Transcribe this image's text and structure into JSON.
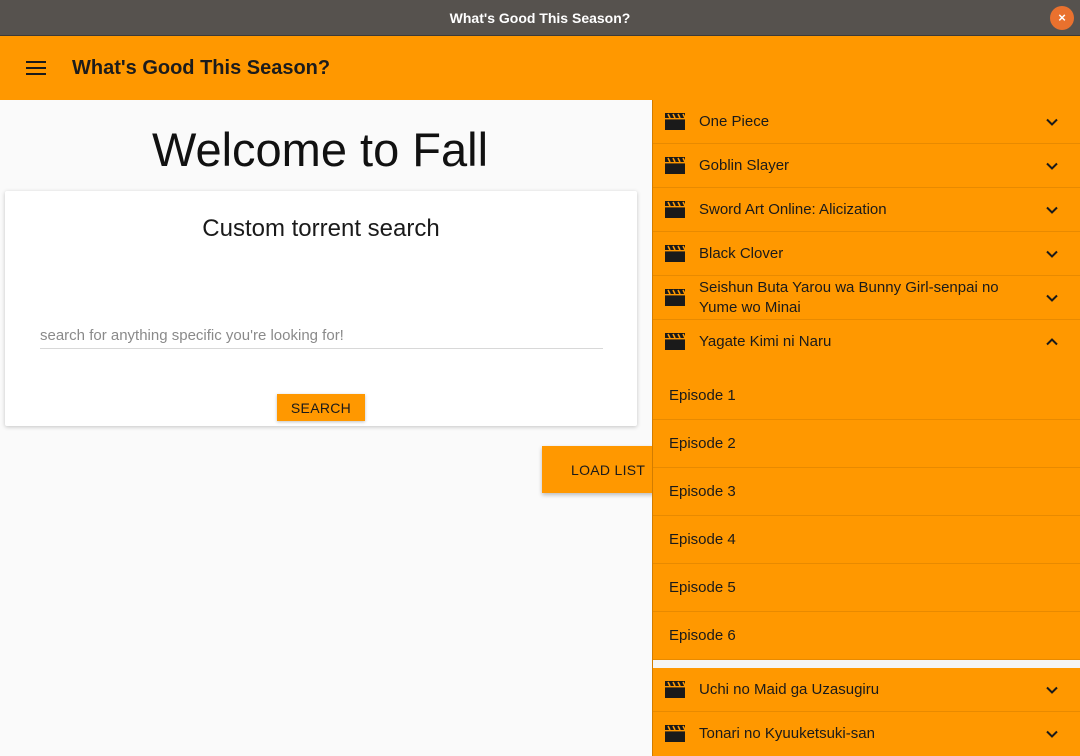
{
  "window": {
    "title": "What's Good This Season?",
    "close_icon": "×"
  },
  "appbar": {
    "title": "What's Good This Season?",
    "menu_icon": "hamburger-menu"
  },
  "main": {
    "welcome": "Welcome to Fall",
    "card": {
      "title": "Custom torrent search",
      "placeholder": "search for anything specific you're looking for!",
      "value": "",
      "button": "SEARCH"
    },
    "load_button": "LOAD LIST"
  },
  "panel": {
    "shows_top": [
      "One Piece",
      "Goblin Slayer",
      "Sword Art Online: Alicization",
      "Black Clover",
      "Seishun Buta Yarou wa Bunny Girl-senpai no Yume wo Minai"
    ],
    "expanded_show": "Yagate Kimi ni Naru",
    "episodes": [
      "Episode 1",
      "Episode 2",
      "Episode 3",
      "Episode 4",
      "Episode 5",
      "Episode 6"
    ],
    "shows_bottom": [
      "Uchi no Maid ga Uzasugiru",
      "Tonari no Kyuuketsuki-san"
    ]
  },
  "colors": {
    "accent": "#ff9800",
    "titlebar": "#56524e",
    "close": "#e9712e"
  }
}
